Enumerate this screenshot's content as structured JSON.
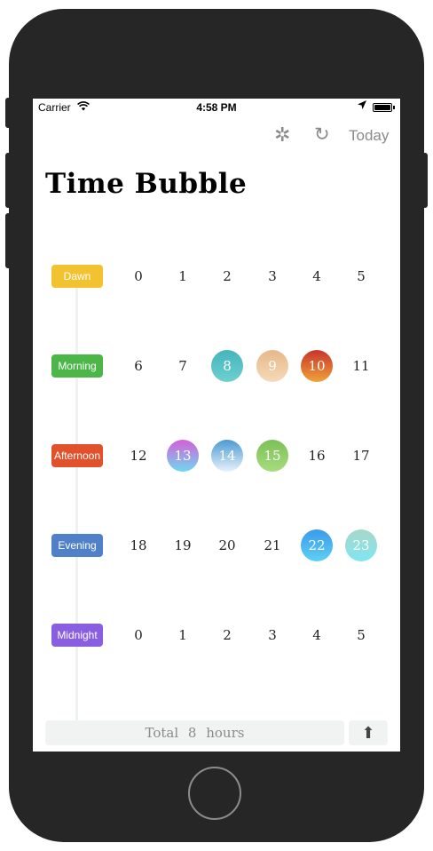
{
  "status": {
    "carrier": "Carrier",
    "wifi_icon": "wifi-icon",
    "time": "4:58 PM",
    "location_icon": "location-arrow-icon",
    "battery_icon": "battery-icon"
  },
  "nav": {
    "gear_glyph": "✲",
    "gear_icon": "settings-icon",
    "refresh_glyph": "↻",
    "refresh_icon": "refresh-icon",
    "today_label": "Today"
  },
  "app": {
    "title": "Time Bubble"
  },
  "rows": [
    {
      "label": "Dawn",
      "color": "#f2c230",
      "hours": [
        {
          "text": "0"
        },
        {
          "text": "1"
        },
        {
          "text": "2"
        },
        {
          "text": "3"
        },
        {
          "text": "4"
        },
        {
          "text": "5"
        }
      ]
    },
    {
      "label": "Morning",
      "color": "#4cb648",
      "hours": [
        {
          "text": "6"
        },
        {
          "text": "7"
        },
        {
          "text": "8",
          "selected": true,
          "bg": "linear-gradient(180deg,#44b5bc,#6ed0cf)"
        },
        {
          "text": "9",
          "selected": true,
          "bg": "linear-gradient(180deg,#e6b88a,#f6dab8)"
        },
        {
          "text": "10",
          "selected": true,
          "bg": "linear-gradient(180deg,#c8342a,#f0a23a)"
        },
        {
          "text": "11"
        }
      ]
    },
    {
      "label": "Afternoon",
      "color": "#e0512c",
      "hours": [
        {
          "text": "12"
        },
        {
          "text": "13",
          "selected": true,
          "bg": "linear-gradient(180deg,#d55fd8,#6ed8f0)"
        },
        {
          "text": "14",
          "selected": true,
          "bg": "linear-gradient(180deg,#4a9ad4,#e9f2fa)"
        },
        {
          "text": "15",
          "selected": true,
          "bg": "linear-gradient(180deg,#7cbf57,#a6dd7e)"
        },
        {
          "text": "16"
        },
        {
          "text": "17"
        }
      ]
    },
    {
      "label": "Evening",
      "color": "#5080c8",
      "hours": [
        {
          "text": "18"
        },
        {
          "text": "19"
        },
        {
          "text": "20"
        },
        {
          "text": "21"
        },
        {
          "text": "22",
          "selected": true,
          "bg": "linear-gradient(180deg,#3a9ae8,#5fd0f5)"
        },
        {
          "text": "23",
          "selected": true,
          "bg": "linear-gradient(180deg,#a8d7c8,#7fe6f2)"
        }
      ]
    },
    {
      "label": "Midnight",
      "color": "#8a5ee0",
      "hours": [
        {
          "text": "0"
        },
        {
          "text": "1"
        },
        {
          "text": "2"
        },
        {
          "text": "3"
        },
        {
          "text": "4"
        },
        {
          "text": "5"
        }
      ]
    }
  ],
  "footer": {
    "total_label": "Total 8 hours",
    "share_glyph": "⬆",
    "share_icon": "share-icon"
  }
}
